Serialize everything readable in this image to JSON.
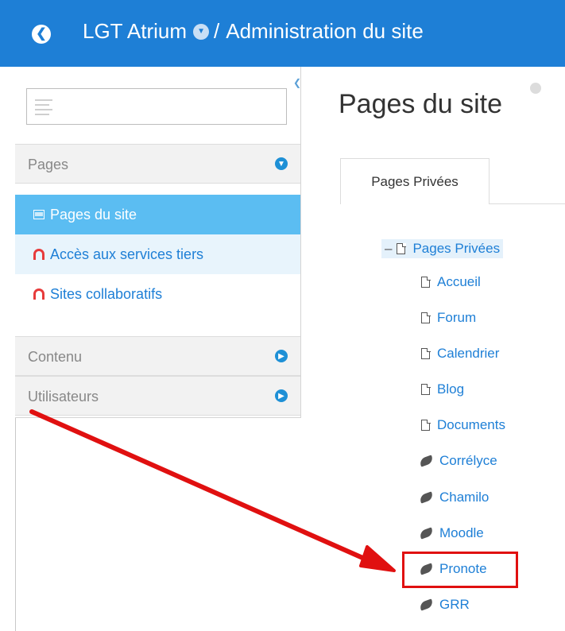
{
  "header": {
    "site_name": "LGT Atrium",
    "separator": "/",
    "section": "Administration du site"
  },
  "sidebar": {
    "search_value": "",
    "sections": [
      {
        "label": "Pages",
        "state": "expanded"
      },
      {
        "label": "Contenu",
        "state": "collapsed"
      },
      {
        "label": "Utilisateurs",
        "state": "collapsed"
      }
    ],
    "items": [
      {
        "label": "Pages du site",
        "icon": "window-icon"
      },
      {
        "label": "Accès aux services tiers",
        "icon": "arc-icon"
      },
      {
        "label": "Sites collaboratifs",
        "icon": "arc-icon"
      }
    ]
  },
  "main": {
    "title": "Pages du site",
    "tab_label": "Pages Privées",
    "tree": {
      "root": "Pages Privées",
      "children": [
        {
          "label": "Accueil",
          "icon": "page-icon"
        },
        {
          "label": "Forum",
          "icon": "page-icon"
        },
        {
          "label": "Calendrier",
          "icon": "page-icon"
        },
        {
          "label": "Blog",
          "icon": "page-icon"
        },
        {
          "label": "Documents",
          "icon": "page-icon"
        },
        {
          "label": "Corrélyce",
          "icon": "leaf-icon"
        },
        {
          "label": "Chamilo",
          "icon": "leaf-icon"
        },
        {
          "label": "Moodle",
          "icon": "leaf-icon"
        },
        {
          "label": "Pronote",
          "icon": "leaf-icon"
        },
        {
          "label": "GRR",
          "icon": "leaf-icon"
        }
      ]
    }
  },
  "colors": {
    "header_bg": "#1e7fd6",
    "active_item_bg": "#5bbdf2",
    "link": "#1e7fd6",
    "annotation": "#e01010"
  }
}
